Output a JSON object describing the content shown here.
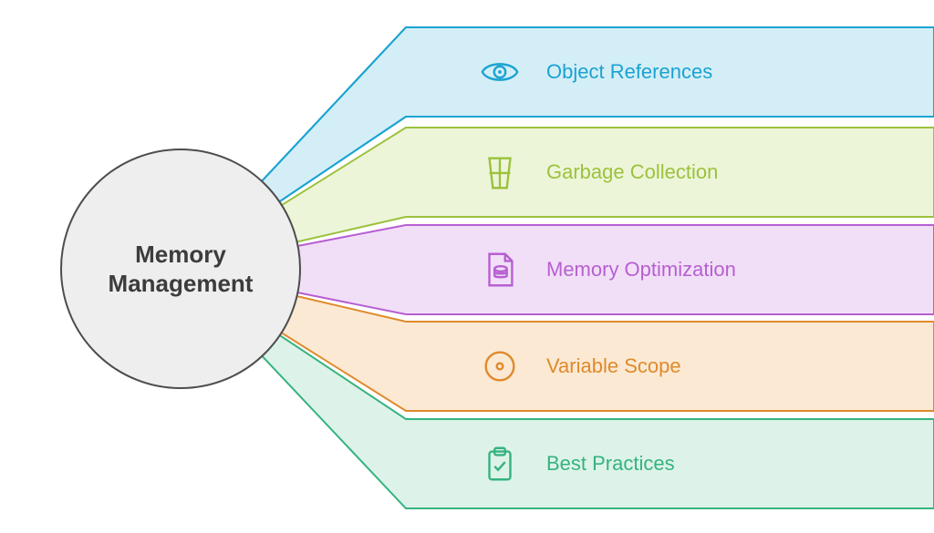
{
  "center": {
    "title_line1": "Memory",
    "title_line2": "Management"
  },
  "bands": [
    {
      "label": "Object References",
      "icon": "eye-icon",
      "color": "#1aa3d1",
      "fill": "#d4eef7"
    },
    {
      "label": "Garbage Collection",
      "icon": "trash-icon",
      "color": "#9bc23c",
      "fill": "#edf5d9"
    },
    {
      "label": "Memory Optimization",
      "icon": "file-db-icon",
      "color": "#b75fd1",
      "fill": "#f1dff8"
    },
    {
      "label": "Variable Scope",
      "icon": "target-icon",
      "color": "#e08a2c",
      "fill": "#fbe9d3"
    },
    {
      "label": "Best Practices",
      "icon": "clipboard-check-icon",
      "color": "#36b37e",
      "fill": "#ddf3e9"
    }
  ]
}
